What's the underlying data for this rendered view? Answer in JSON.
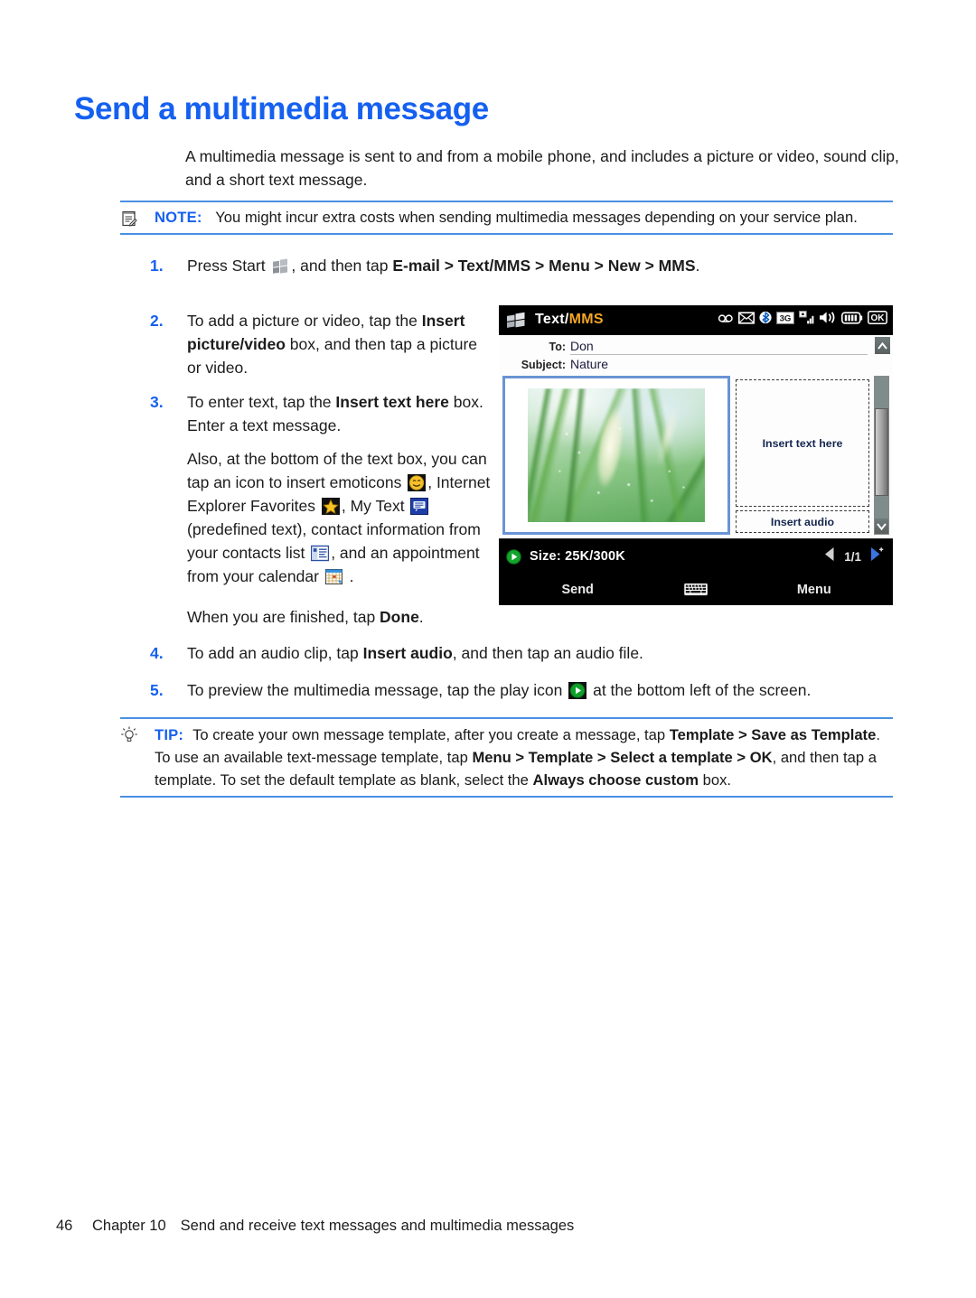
{
  "page": {
    "heading": "Send a multimedia message",
    "intro": "A multimedia message is sent to and from a mobile phone, and includes a picture or video, sound clip, and a short text message."
  },
  "note": {
    "icon": "note-icon",
    "label": "NOTE:",
    "text": "You might incur extra costs when sending multimedia messages depending on your service plan."
  },
  "tip": {
    "icon": "tip-bulb-icon",
    "label": "TIP:",
    "p1_a": "To create your own message template, after you create a message, tap ",
    "p1_b": "Template > Save as Template",
    "p1_c": ". To use an available text-message template, tap ",
    "p1_d": "Menu > Template > Select a template > OK",
    "p1_e": ", and then tap a template. To set the default template as blank, select the ",
    "p1_f": "Always choose custom",
    "p1_g": " box."
  },
  "steps": {
    "s1": {
      "num": "1.",
      "a": "Press Start ",
      "b": ", and then tap ",
      "c": "E-mail > Text/MMS > Menu > New > MMS",
      "d": "."
    },
    "s2": {
      "num": "2.",
      "a": "To add a picture or video, tap the ",
      "b": "Insert picture/video",
      "c": " box, and then tap a picture or video."
    },
    "s3": {
      "num": "3.",
      "a": "To enter text, tap the ",
      "b": "Insert text here",
      "c": " box. Enter a text message."
    },
    "s3b": {
      "a": "Also, at the bottom of the text box, you can tap an icon to insert emoticons ",
      "b": ", Internet Explorer Favorites ",
      "c": ", My Text ",
      "d": " (predefined text), contact information from your contacts list ",
      "e": ", and an appointment from your calendar ",
      "f": " ."
    },
    "s3c": {
      "a": "When you are finished, tap ",
      "b": "Done",
      "c": "."
    },
    "s4": {
      "num": "4.",
      "a": "To add an audio clip, tap ",
      "b": "Insert audio",
      "c": ", and then tap an audio file."
    },
    "s5": {
      "num": "5.",
      "a": "To preview the multimedia message, tap the play icon ",
      "b": " at the bottom left of the screen."
    }
  },
  "phone": {
    "titlebar": {
      "start_icon": "windows-start-icon",
      "title_main": "Text",
      "title_slash": "/",
      "title_accent": "MMS",
      "status_icons": [
        "voicemail-icon",
        "envelope-icon",
        "bluetooth-icon",
        "3g-icon",
        "signal-bars-icon",
        "volume-icon",
        "battery-icon",
        "ok-icon"
      ],
      "three_g_label": "3G",
      "ok_label": "OK"
    },
    "fields": {
      "to_label": "To:",
      "to_value": "Don",
      "subject_label": "Subject:",
      "subject_value": "Nature"
    },
    "slide": {
      "picture_alt": "nature-grass-photo",
      "insert_text_here": "Insert text here",
      "insert_audio": "Insert audio"
    },
    "statusline": {
      "play_icon": "play-icon",
      "size": "Size: 25K/300K",
      "prev_icon": "prev-slide-icon",
      "page": "1/1",
      "next_icon": "next-slide-icon"
    },
    "softkeys": {
      "left": "Send",
      "center_icon": "keyboard-icon",
      "right": "Menu"
    }
  },
  "footer": {
    "page_number": "46",
    "chapter": "Chapter 10",
    "title": "Send and receive text messages and multimedia messages"
  },
  "colors": {
    "accent_blue": "#1560f0",
    "rule_blue": "#4a90e2",
    "amber": "#f5a623"
  }
}
